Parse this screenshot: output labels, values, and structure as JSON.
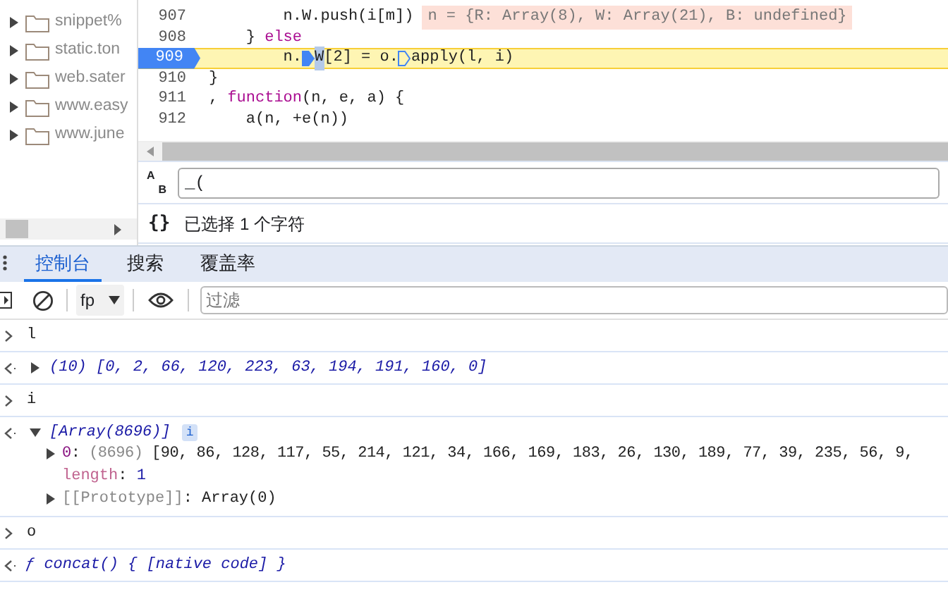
{
  "file_tree": [
    {
      "label": "snippet%",
      "expanded": false
    },
    {
      "label": "static.ton",
      "expanded": false
    },
    {
      "label": "web.sater",
      "expanded": false
    },
    {
      "label": "www.easy",
      "expanded": false
    },
    {
      "label": "www.june",
      "expanded": false
    }
  ],
  "code": {
    "lines": [
      {
        "number": "907",
        "paused": false,
        "tokens": [
          {
            "text": "        n.W.push(i[m])",
            "kind": "plain"
          }
        ],
        "inline_value": "n = {R: Array(8), W: Array(21), B: undefined}"
      },
      {
        "number": "908",
        "paused": false,
        "tokens": [
          {
            "text": "    } ",
            "kind": "plain"
          },
          {
            "text": "else",
            "kind": "keyword"
          }
        ]
      },
      {
        "number": "909",
        "paused": true,
        "tokens": [
          {
            "text": "        n.",
            "kind": "plain"
          },
          {
            "kind": "marker_active"
          },
          {
            "text": "W",
            "kind": "selected"
          },
          {
            "text": "[2] = o.",
            "kind": "plain"
          },
          {
            "kind": "marker"
          },
          {
            "text": "apply(l, i)",
            "kind": "plain"
          }
        ]
      },
      {
        "number": "910",
        "paused": false,
        "tokens": [
          {
            "text": "}",
            "kind": "plain"
          }
        ]
      },
      {
        "number": "911",
        "paused": false,
        "tokens": [
          {
            "text": ", ",
            "kind": "plain"
          },
          {
            "text": "function",
            "kind": "keyword"
          },
          {
            "text": "(n, e, a) {",
            "kind": "plain"
          }
        ]
      },
      {
        "number": "912",
        "paused": false,
        "tokens": [
          {
            "text": "    a(n, +e(n))",
            "kind": "plain"
          }
        ]
      }
    ]
  },
  "search": {
    "icon_letters": [
      "A",
      "B"
    ],
    "value": "_("
  },
  "status": {
    "icon": "{}",
    "text": "已选择 1 个字符"
  },
  "tabs": [
    {
      "label": "控制台",
      "selected": true
    },
    {
      "label": "搜索",
      "selected": false
    },
    {
      "label": "覆盖率",
      "selected": false
    }
  ],
  "toolbar": {
    "context": "fp",
    "filter_placeholder": "过滤"
  },
  "console": [
    {
      "kind": "input",
      "text": "l"
    },
    {
      "kind": "output",
      "expanded": false,
      "text": "(10) [0, 2, 66, 120, 223, 63, 194, 191, 160, 0]"
    },
    {
      "kind": "input",
      "text": "i"
    },
    {
      "kind": "output",
      "expanded": true,
      "text": "[Array(8696)]",
      "badge": "i",
      "children": [
        {
          "key": "0",
          "kind": "index",
          "separator": ":",
          "expanded": false,
          "count": "(8696)",
          "value": "[90, 86, 128, 117, 55, 214, 121, 34, 166, 169, 183, 26, 130, 189, 77, 39, 235, 56, 9,"
        },
        {
          "key": "length",
          "kind": "property",
          "separator": ":",
          "value": "1"
        },
        {
          "key": "[[Prototype]]",
          "kind": "internal",
          "separator": ":",
          "expanded": false,
          "value": "Array(0)"
        }
      ]
    },
    {
      "kind": "input",
      "text": "o"
    },
    {
      "kind": "output",
      "text": "ƒ concat() { [native code] }"
    }
  ]
}
